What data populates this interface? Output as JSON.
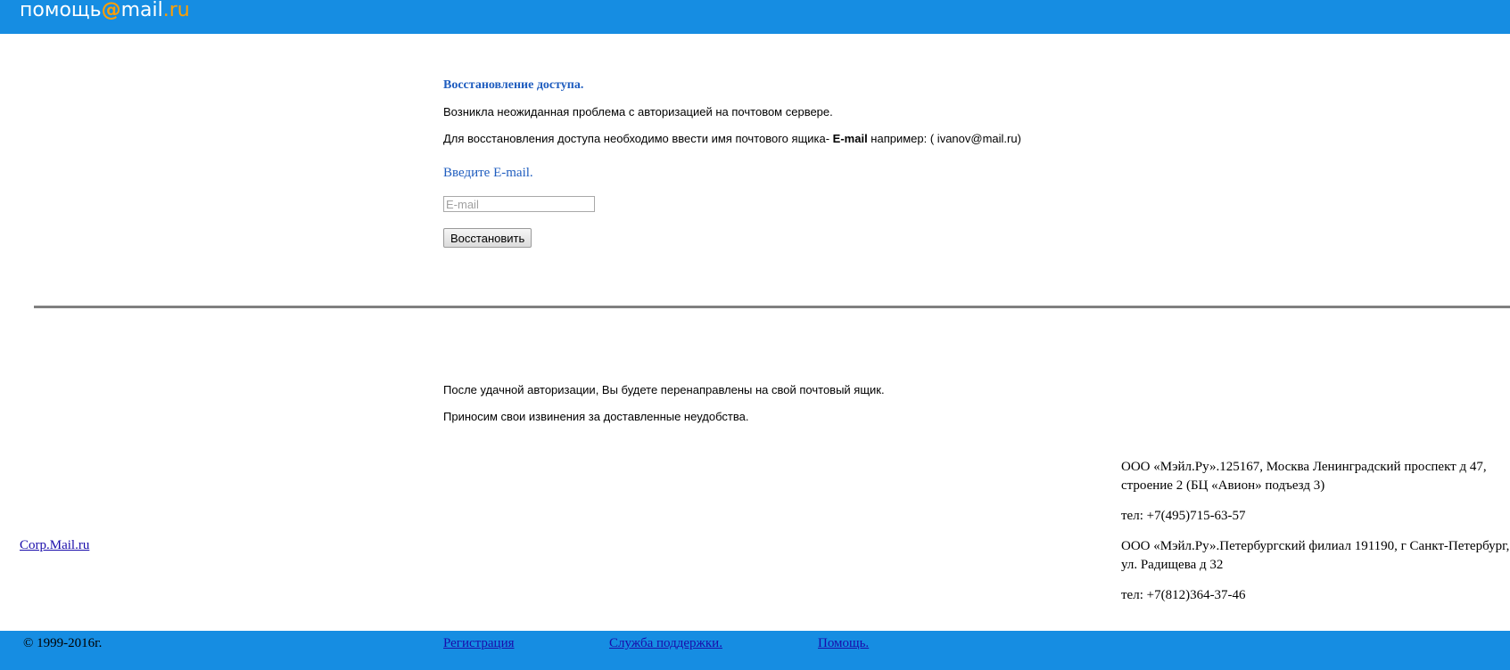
{
  "header": {
    "logo_prefix": "помощь",
    "logo_at": "@",
    "logo_mail": "mail",
    "logo_ru": ".ru"
  },
  "main": {
    "title": "Восстановление доступа.",
    "paragraph1": "Возникла неожиданная проблема с авторизацией на почтовом сервере.",
    "paragraph2_prefix": "Для восстановления доступа необходимо ввести имя почтового ящика- ",
    "paragraph2_bold": "E-mail",
    "paragraph2_suffix": " например: ( ivanov@mail.ru)",
    "prompt": "Введите E-mail.",
    "email_placeholder": "E-mail",
    "email_value": "",
    "restore_button": "Восстановить",
    "after_line1": "После удачной авторизации, Вы будете перенаправлены на свой почтовый ящик.",
    "after_line2": "Приносим свои извинения за доставленные неудобства."
  },
  "company": {
    "moscow_line1": "ООО «Мэйл.Ру».125167, Москва Ленинградский проспект д 47,",
    "moscow_line2": "строение 2 (БЦ «Авион» подъезд 3)",
    "moscow_phone": "тел: +7(495)715-63-57",
    "spb_line1": "ООО «Мэйл.Ру».Петербургский филиал 191190, г Санкт-Петербург,",
    "spb_line2": "ул. Радищева д 32",
    "spb_phone": "тел: +7(812)364-37-46"
  },
  "corp_link": "Corp.Mail.ru",
  "footer": {
    "copyright": "© 1999-2016г.",
    "registration": "Регистрация ",
    "support": "Служба поддержки.",
    "help": "Помощь."
  },
  "colors": {
    "brand_blue": "#168de2",
    "logo_accent": "#ff9e00",
    "heading_blue": "#1f5dbf"
  }
}
